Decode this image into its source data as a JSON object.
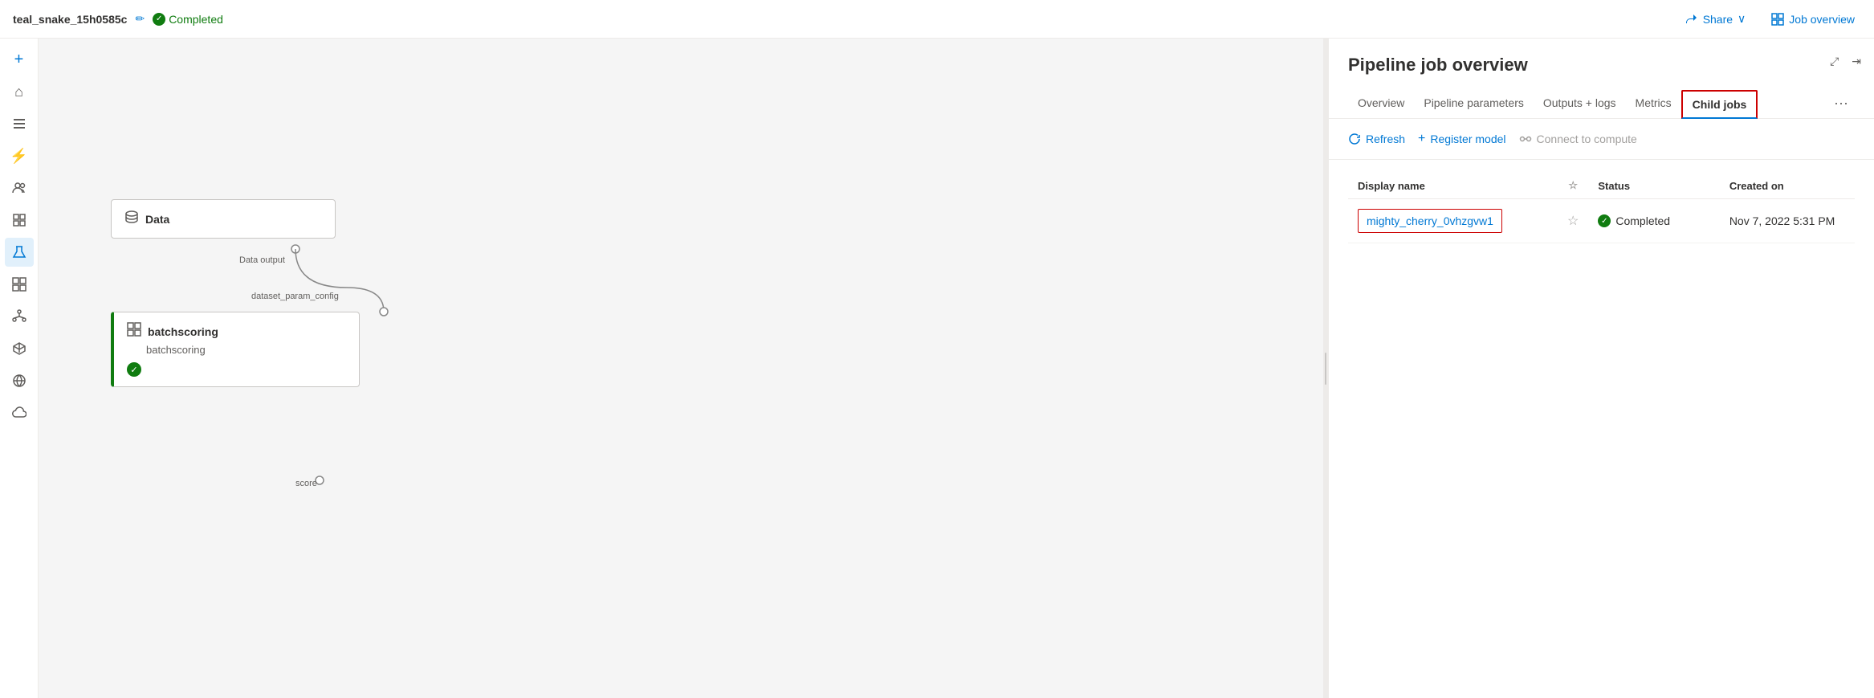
{
  "topbar": {
    "title": "teal_snake_15h0585c",
    "status": "Completed",
    "share_label": "Share",
    "job_overview_label": "Job overview"
  },
  "sidebar": {
    "items": [
      {
        "id": "plus",
        "icon": "+",
        "label": "Add"
      },
      {
        "id": "home",
        "icon": "⌂",
        "label": "Home"
      },
      {
        "id": "list",
        "icon": "☰",
        "label": "List"
      },
      {
        "id": "lightning",
        "icon": "⚡",
        "label": "Lightning"
      },
      {
        "id": "people",
        "icon": "👥",
        "label": "People"
      },
      {
        "id": "grid",
        "icon": "⊞",
        "label": "Grid"
      },
      {
        "id": "flask",
        "icon": "⚗",
        "label": "Flask",
        "active": true
      },
      {
        "id": "modules",
        "icon": "⧉",
        "label": "Modules"
      },
      {
        "id": "tree",
        "icon": "❖",
        "label": "Tree"
      },
      {
        "id": "box",
        "icon": "◈",
        "label": "Box"
      },
      {
        "id": "cube",
        "icon": "▣",
        "label": "Cube"
      },
      {
        "id": "cloud",
        "icon": "☁",
        "label": "Cloud"
      }
    ]
  },
  "pipeline": {
    "nodes": {
      "data": {
        "label": "Data",
        "output_label": "Data output",
        "param_label": "dataset_param_config"
      },
      "batchscoring": {
        "title": "batchscoring",
        "subtitle": "batchscoring",
        "score_label": "score"
      }
    }
  },
  "panel": {
    "title": "Pipeline job overview",
    "tabs": [
      {
        "id": "overview",
        "label": "Overview"
      },
      {
        "id": "pipeline-params",
        "label": "Pipeline parameters"
      },
      {
        "id": "outputs-logs",
        "label": "Outputs + logs"
      },
      {
        "id": "metrics",
        "label": "Metrics"
      },
      {
        "id": "child-jobs",
        "label": "Child jobs",
        "active": true
      }
    ],
    "toolbar": {
      "refresh_label": "Refresh",
      "register_model_label": "Register model",
      "connect_label": "Connect to compute"
    },
    "table": {
      "headers": {
        "display_name": "Display name",
        "status": "Status",
        "created_on": "Created on"
      },
      "rows": [
        {
          "name": "mighty_cherry_0vhzgvw1",
          "status": "Completed",
          "created_on": "Nov 7, 2022 5:31 PM"
        }
      ]
    }
  }
}
